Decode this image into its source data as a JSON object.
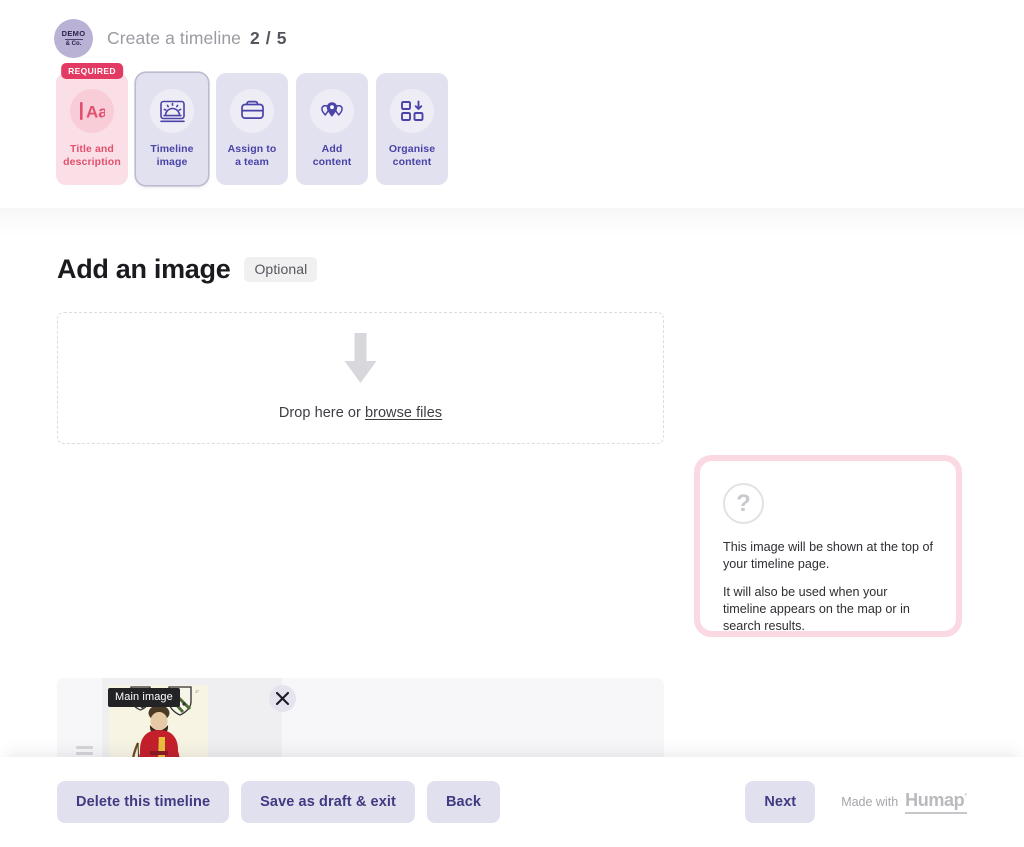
{
  "header": {
    "logo": {
      "line1": "DEMO",
      "line2": "& Co.",
      "name": "demo-co-logo"
    },
    "breadcrumb_title": "Create a timeline",
    "step_counter": "2 / 5",
    "steps": [
      {
        "label": "Title and\ndescription",
        "label_line1": "Title and",
        "label_line2": "description",
        "icon": "text-format-icon",
        "badge": "REQUIRED",
        "state": "required"
      },
      {
        "label_line1": "Timeline",
        "label_line2": "image",
        "icon": "image-landscape-icon",
        "badge": "",
        "state": "active"
      },
      {
        "label_line1": "Assign to",
        "label_line2": "a team",
        "icon": "folder-icon",
        "badge": "",
        "state": "default"
      },
      {
        "label_line1": "Add",
        "label_line2": "content",
        "icon": "map-pin-icon",
        "badge": "",
        "state": "default"
      },
      {
        "label_line1": "Organise",
        "label_line2": "content",
        "icon": "organise-grid-icon",
        "badge": "",
        "state": "default"
      }
    ]
  },
  "main": {
    "title": "Add an image",
    "optional_chip": "Optional",
    "dropzone": {
      "icon": "arrow-down-icon",
      "text_prefix": "Drop here or ",
      "browse_link": "browse files"
    },
    "uploaded": {
      "drag_handle_icon": "drag-handle-icon",
      "badge": "Main image",
      "close_icon": "close-icon",
      "image_alt": "Historic illustration of an archer in red robes with heraldic shields"
    }
  },
  "help": {
    "icon": "question-mark-icon",
    "paragraph_1": "This image will be shown at the top of your timeline page.",
    "paragraph_2": "It will also be used when your timeline appears on the map or in search results."
  },
  "footer": {
    "delete_label": "Delete this timeline",
    "save_draft_label": "Save as draft & exit",
    "back_label": "Back",
    "next_label": "Next",
    "made_with_label": "Made with",
    "brand": "Humap",
    "brand_tm": "°"
  },
  "colors": {
    "accent_purple": "#4a43a8",
    "step_bg": "#e2e1ef",
    "required_pink": "#e23a63",
    "required_bg": "#fbdfe6",
    "help_border": "#fbd9e3",
    "button_bg": "#e1e0ee"
  }
}
